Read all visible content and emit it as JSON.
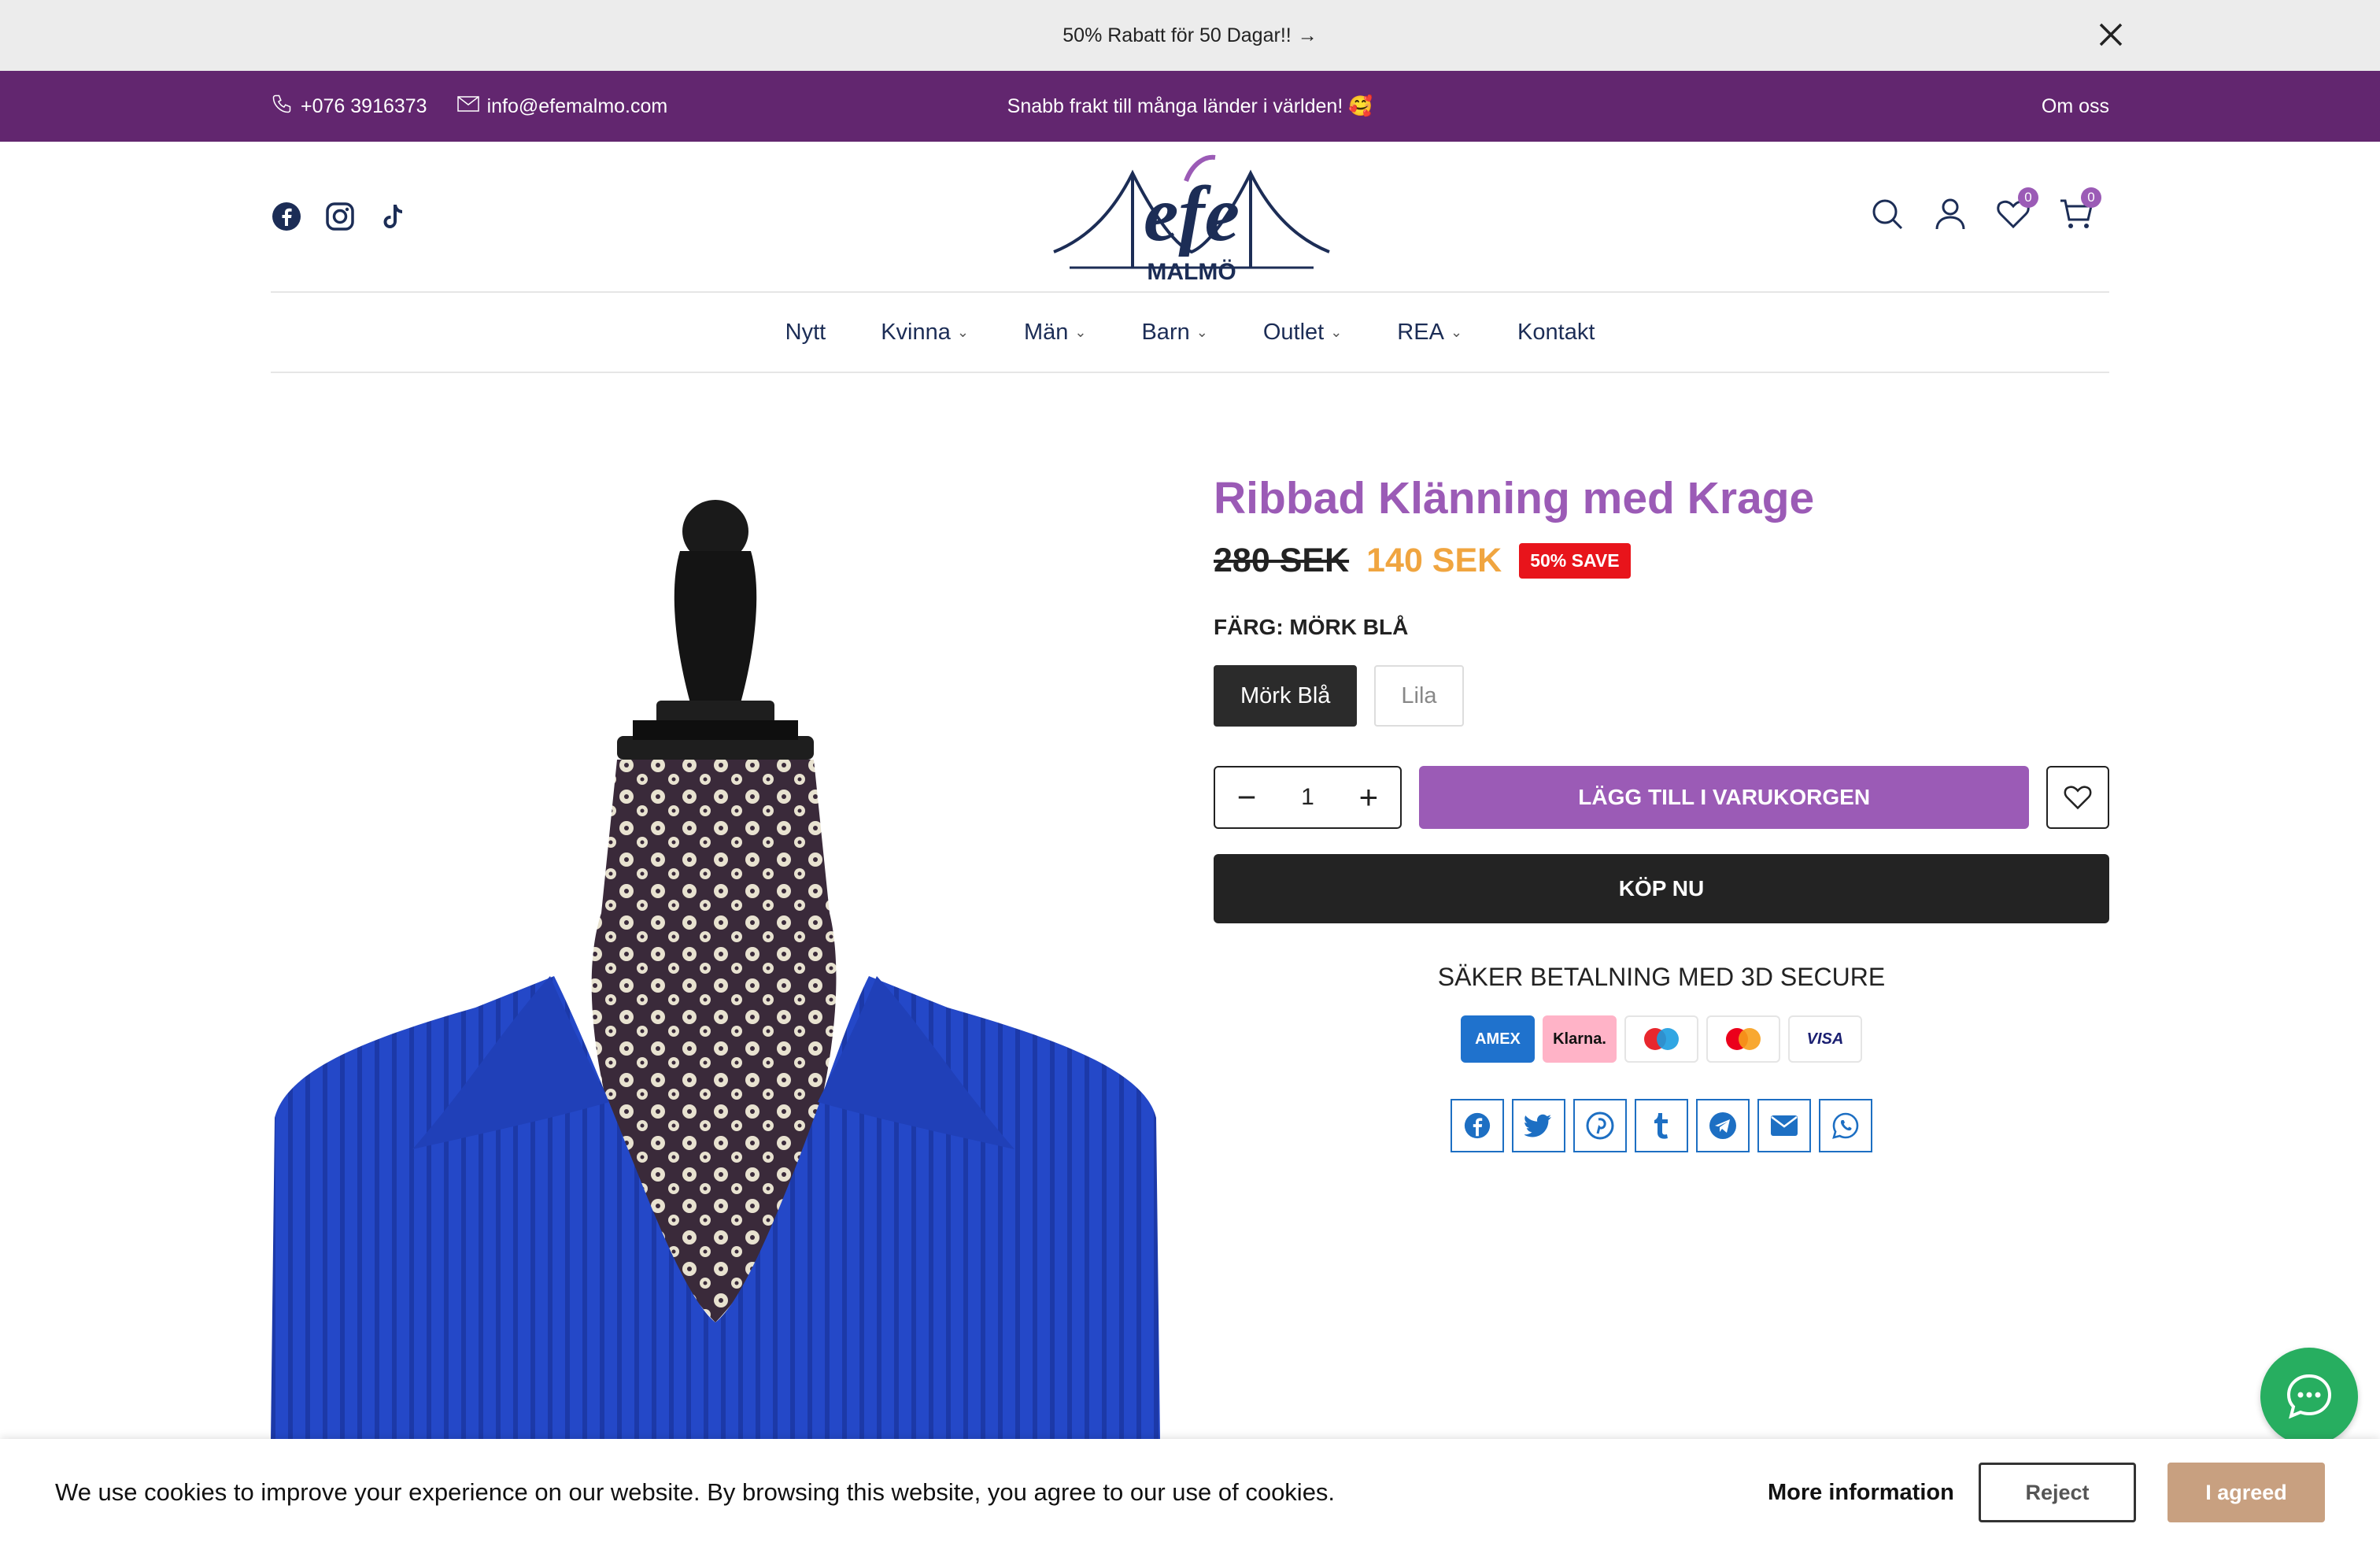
{
  "announcement": {
    "text": "50% Rabatt för 50 Dagar!!",
    "arrow": "→"
  },
  "topbar": {
    "phone": "+076 3916373",
    "email": "info@efemalmo.com",
    "shipping": "Snabb frakt till många länder i världen! 🥰",
    "about": "Om oss"
  },
  "header": {
    "social": [
      "facebook-icon",
      "instagram-icon",
      "tiktok-icon"
    ],
    "logo_text": "efe",
    "logo_sub": "MALMÖ",
    "wishlist_count": "0",
    "cart_count": "0"
  },
  "nav": {
    "items": [
      {
        "label": "Nytt"
      },
      {
        "label": "Kvinna"
      },
      {
        "label": "Män"
      },
      {
        "label": "Barn"
      },
      {
        "label": "Outlet"
      },
      {
        "label": "REA"
      },
      {
        "label": "Kontakt"
      }
    ]
  },
  "product": {
    "title": "Ribbad Klänning med Krage",
    "old_price": "280 SEK",
    "new_price": "140 SEK",
    "save_badge": "50% SAVE",
    "color_label": "FÄRG: MÖRK BLÅ",
    "colors": [
      "Mörk Blå",
      "Lila"
    ],
    "quantity": "1",
    "add_to_cart": "LÄGG TILL I VARUKORGEN",
    "buy_now": "KÖP NU",
    "secure_text": "SÄKER BETALNING MED 3D SECURE",
    "payments": [
      "AMEX",
      "Klarna.",
      "Maestro",
      "Mastercard",
      "VISA"
    ],
    "shares": [
      "facebook-icon",
      "twitter-icon",
      "pinterest-icon",
      "tumblr-icon",
      "telegram-icon",
      "email-icon",
      "whatsapp-icon"
    ]
  },
  "cookie": {
    "text": "We use cookies to improve your experience on our website. By browsing this website, you agree to our use of cookies.",
    "more": "More information",
    "reject": "Reject",
    "agree": "I agreed"
  },
  "colors": {
    "purple": "#62266f",
    "accent": "#9b5bb6",
    "price_orange": "#f0a540",
    "save_red": "#e8141b",
    "chat_green": "#27ae60"
  }
}
